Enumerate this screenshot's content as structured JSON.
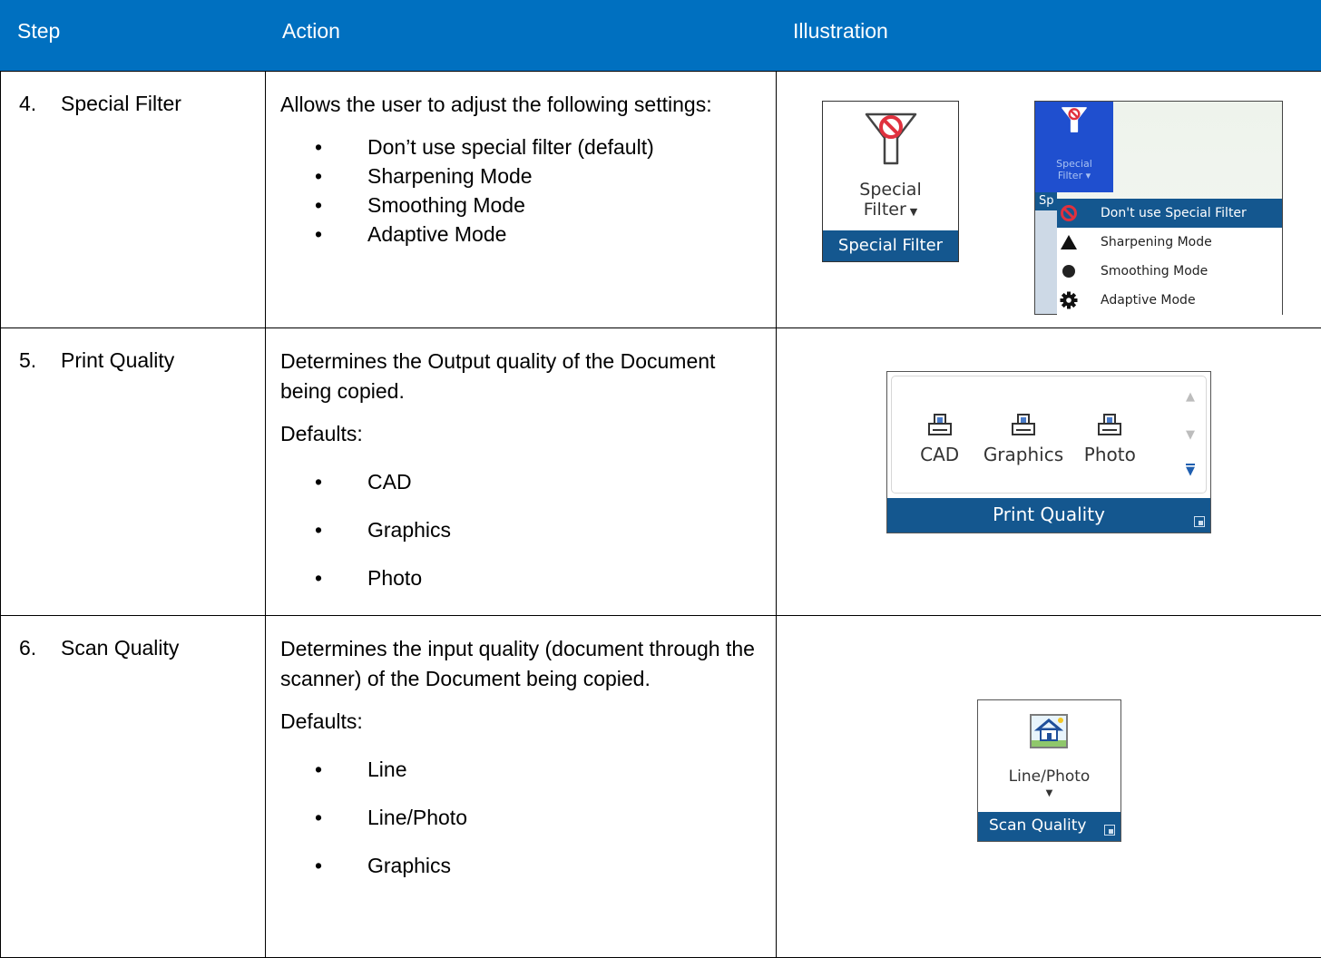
{
  "header": {
    "step": "Step",
    "action": "Action",
    "illustration": "Illustration"
  },
  "rows": [
    {
      "num": "4.",
      "step": "Special Filter",
      "intro": "Allows the user to adjust the following settings:",
      "items": [
        "Don’t use special filter (default)",
        "Sharpening Mode",
        "Smoothing Mode",
        "Adaptive Mode"
      ],
      "illustration": {
        "button_label_1": "Special",
        "button_label_2": "Filter",
        "group_label": "Special Filter",
        "menu_button_label_1": "Special",
        "menu_button_label_2": "Filter",
        "menu_group_label_fragment": "Sp",
        "menu_items": [
          "Don't use Special Filter",
          "Sharpening Mode",
          "Smoothing Mode",
          "Adaptive Mode"
        ],
        "selected_index": 0
      }
    },
    {
      "num": "5.",
      "step": "Print Quality",
      "intro": "Determines the Output quality of the Document being copied.",
      "defaults_label": "Defaults:",
      "items": [
        "CAD",
        "Graphics",
        "Photo"
      ],
      "illustration": {
        "options": [
          "CAD",
          "Graphics",
          "Photo"
        ],
        "group_label": "Print Quality"
      }
    },
    {
      "num": "6.",
      "step": "Scan Quality",
      "intro": "Determines the input quality (document through the scanner) of the Document being copied.",
      "defaults_label": "Defaults:",
      "items": [
        "Line",
        "Line/Photo",
        "Graphics"
      ],
      "illustration": {
        "button_label": "Line/Photo",
        "group_label": "Scan Quality"
      }
    }
  ],
  "colors": {
    "header_bg": "#0070c0",
    "ribbon_blue": "#14578f"
  },
  "icons": [
    "filter-no-icon",
    "prohibited-icon",
    "triangle-icon",
    "circle-icon",
    "gear-icon",
    "printer-icon",
    "house-photo-icon",
    "dropdown-arrow-icon",
    "launcher-icon"
  ]
}
